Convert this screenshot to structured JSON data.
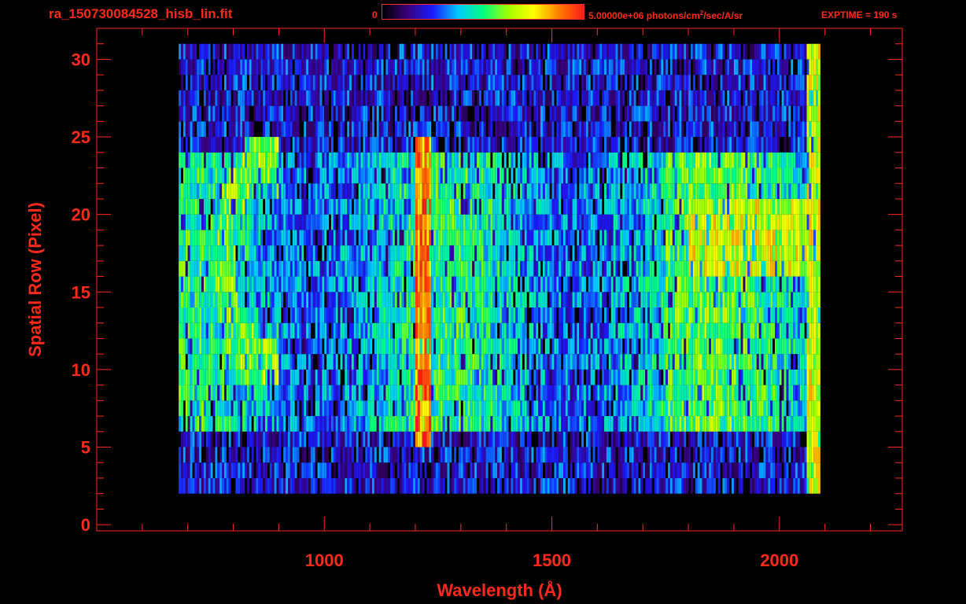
{
  "header": {
    "file_title": "ra_150730084528_hisb_lin.fit",
    "colorbar_min": "0",
    "colorbar_max_prefix": "5.00000e+06 photons/cm",
    "colorbar_max_exp": "2",
    "colorbar_max_suffix": "/sec/A/sr",
    "exptime": "EXPTIME = 190 s"
  },
  "colors": {
    "axis": "#ff2a1a",
    "background": "#000000",
    "colormap": [
      "#000000",
      "#3a007a",
      "#1a1aff",
      "#00c8ff",
      "#00ff80",
      "#a0ff00",
      "#ffff00",
      "#ff8000",
      "#ff1a1a"
    ]
  },
  "chart_data": {
    "type": "heatmap",
    "title": "",
    "xlabel": "Wavelength (Å)",
    "ylabel": "Spatial Row (Pixel)",
    "xlim": [
      500,
      2270
    ],
    "ylim": [
      -0.4,
      32
    ],
    "xticks": [
      1000,
      1500,
      2000
    ],
    "yticks": [
      0,
      5,
      10,
      15,
      20,
      25,
      30
    ],
    "colorbar": {
      "min": 0,
      "max": 5000000.0,
      "unit": "photons/cm2/sec/A/sr"
    },
    "data_extent": {
      "x": [
        680,
        2090
      ],
      "rows": [
        2,
        30
      ]
    },
    "features": [
      {
        "name": "bright line",
        "x": 1216,
        "rows": [
          5,
          24
        ],
        "level": 0.88
      },
      {
        "name": "arc",
        "x": 800,
        "rows": [
          10,
          23
        ],
        "level": 0.6
      },
      {
        "name": "band",
        "x": [
          1800,
          2070
        ],
        "rows": [
          16,
          20
        ],
        "level": 0.7
      }
    ]
  }
}
